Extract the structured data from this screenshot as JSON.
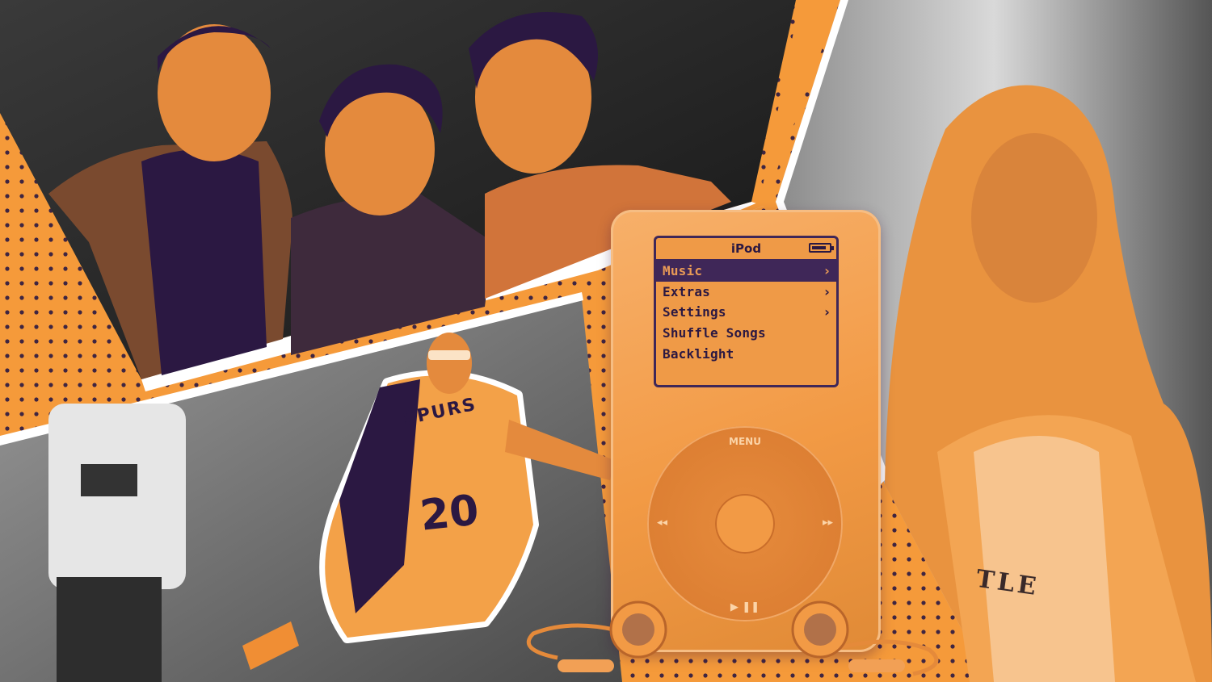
{
  "colors": {
    "orange": "#f59a3a",
    "purple": "#2b1842",
    "dark": "#1c1c1c"
  },
  "ipod": {
    "title": "iPod",
    "battery_level": 0.85,
    "menu": [
      {
        "label": "Music",
        "chevron": "›",
        "selected": true
      },
      {
        "label": "Extras",
        "chevron": "›",
        "selected": false
      },
      {
        "label": "Settings",
        "chevron": "›",
        "selected": false
      },
      {
        "label": "Shuffle Songs",
        "chevron": "",
        "selected": false
      },
      {
        "label": "Backlight",
        "chevron": "",
        "selected": false
      }
    ],
    "wheel": {
      "menu_label": "MENU",
      "prev_glyph": "◂◂",
      "next_glyph": "▸▸",
      "play_glyph": "▶ ❚❚"
    }
  },
  "jersey": {
    "team": "SPURS",
    "number": "20"
  },
  "tshirt": {
    "text": "TLE"
  }
}
